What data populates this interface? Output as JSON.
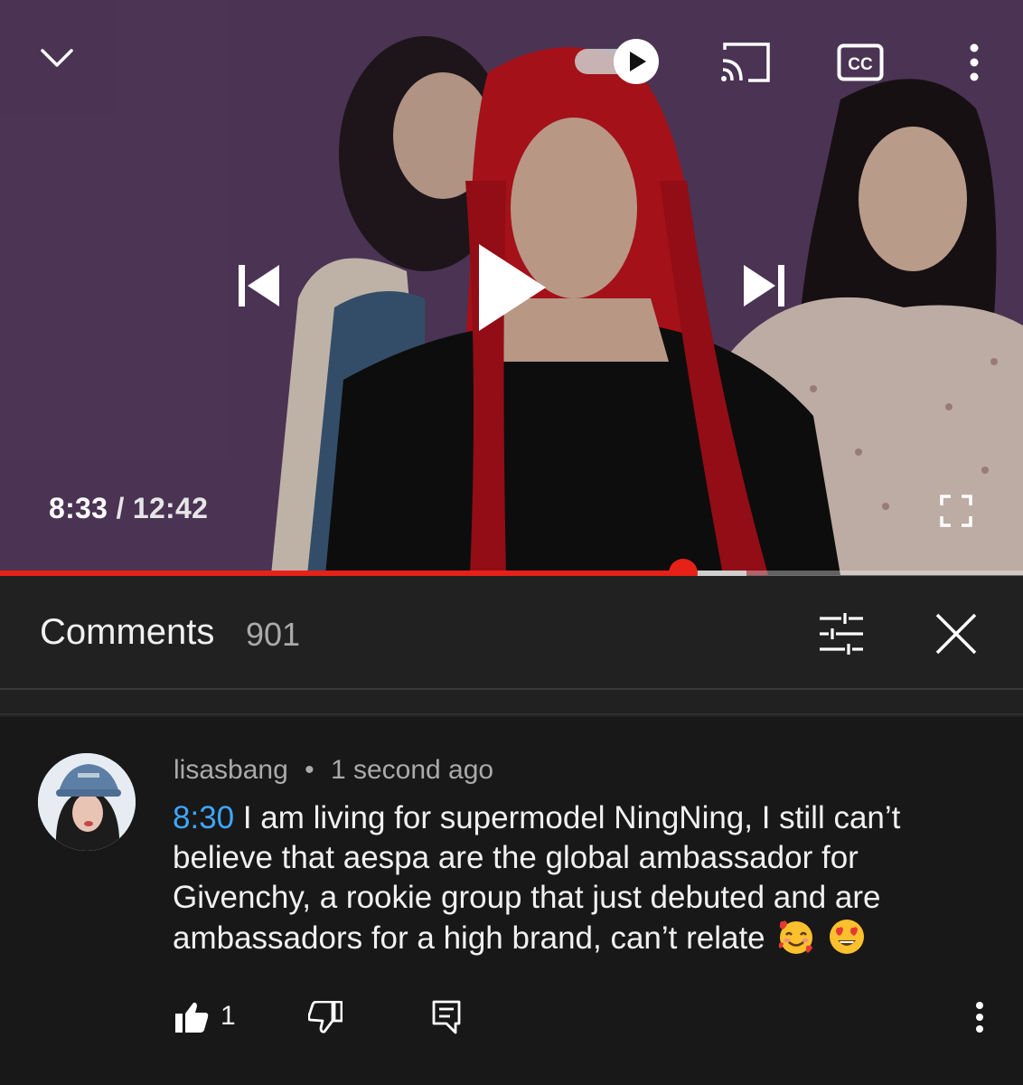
{
  "player": {
    "current_time": "8:33",
    "separator": "/",
    "total_time": "12:42",
    "progress_fraction": 0.668,
    "buffered_fraction": 0.73,
    "autoplay_on": true,
    "icons": {
      "collapse": "chevron-down-icon",
      "autoplay": "autoplay-toggle-icon",
      "cast": "cast-icon",
      "captions": "closed-captions-icon",
      "more": "more-vert-icon",
      "previous": "skip-previous-icon",
      "play": "play-icon",
      "next": "skip-next-icon",
      "fullscreen": "fullscreen-icon"
    },
    "captions_label": "CC"
  },
  "comments_panel": {
    "title": "Comments",
    "count": "901",
    "icons": {
      "sort": "sort-filter-icon",
      "close": "close-icon"
    }
  },
  "comment": {
    "author": "lisasbang",
    "dot": "•",
    "time_ago": "1 second ago",
    "timestamp_link": "8:30",
    "text": "I am living for supermodel NingNing, I still can’t believe that aespa are the global ambassador for Givenchy, a rookie group that just debuted and are ambassadors for a high brand, can’t relate",
    "emojis": [
      "smiling-face-with-hearts",
      "heart-eyes"
    ],
    "like_count": "1",
    "icons": {
      "like": "thumbs-up-icon",
      "dislike": "thumbs-down-icon",
      "reply": "reply-icon",
      "more": "more-vert-icon"
    }
  },
  "colors": {
    "accent_red": "#e62117",
    "link_blue": "#3ea6ff",
    "panel_bg": "#212121",
    "comment_bg": "#181818",
    "muted_text": "#aaaaaa"
  }
}
